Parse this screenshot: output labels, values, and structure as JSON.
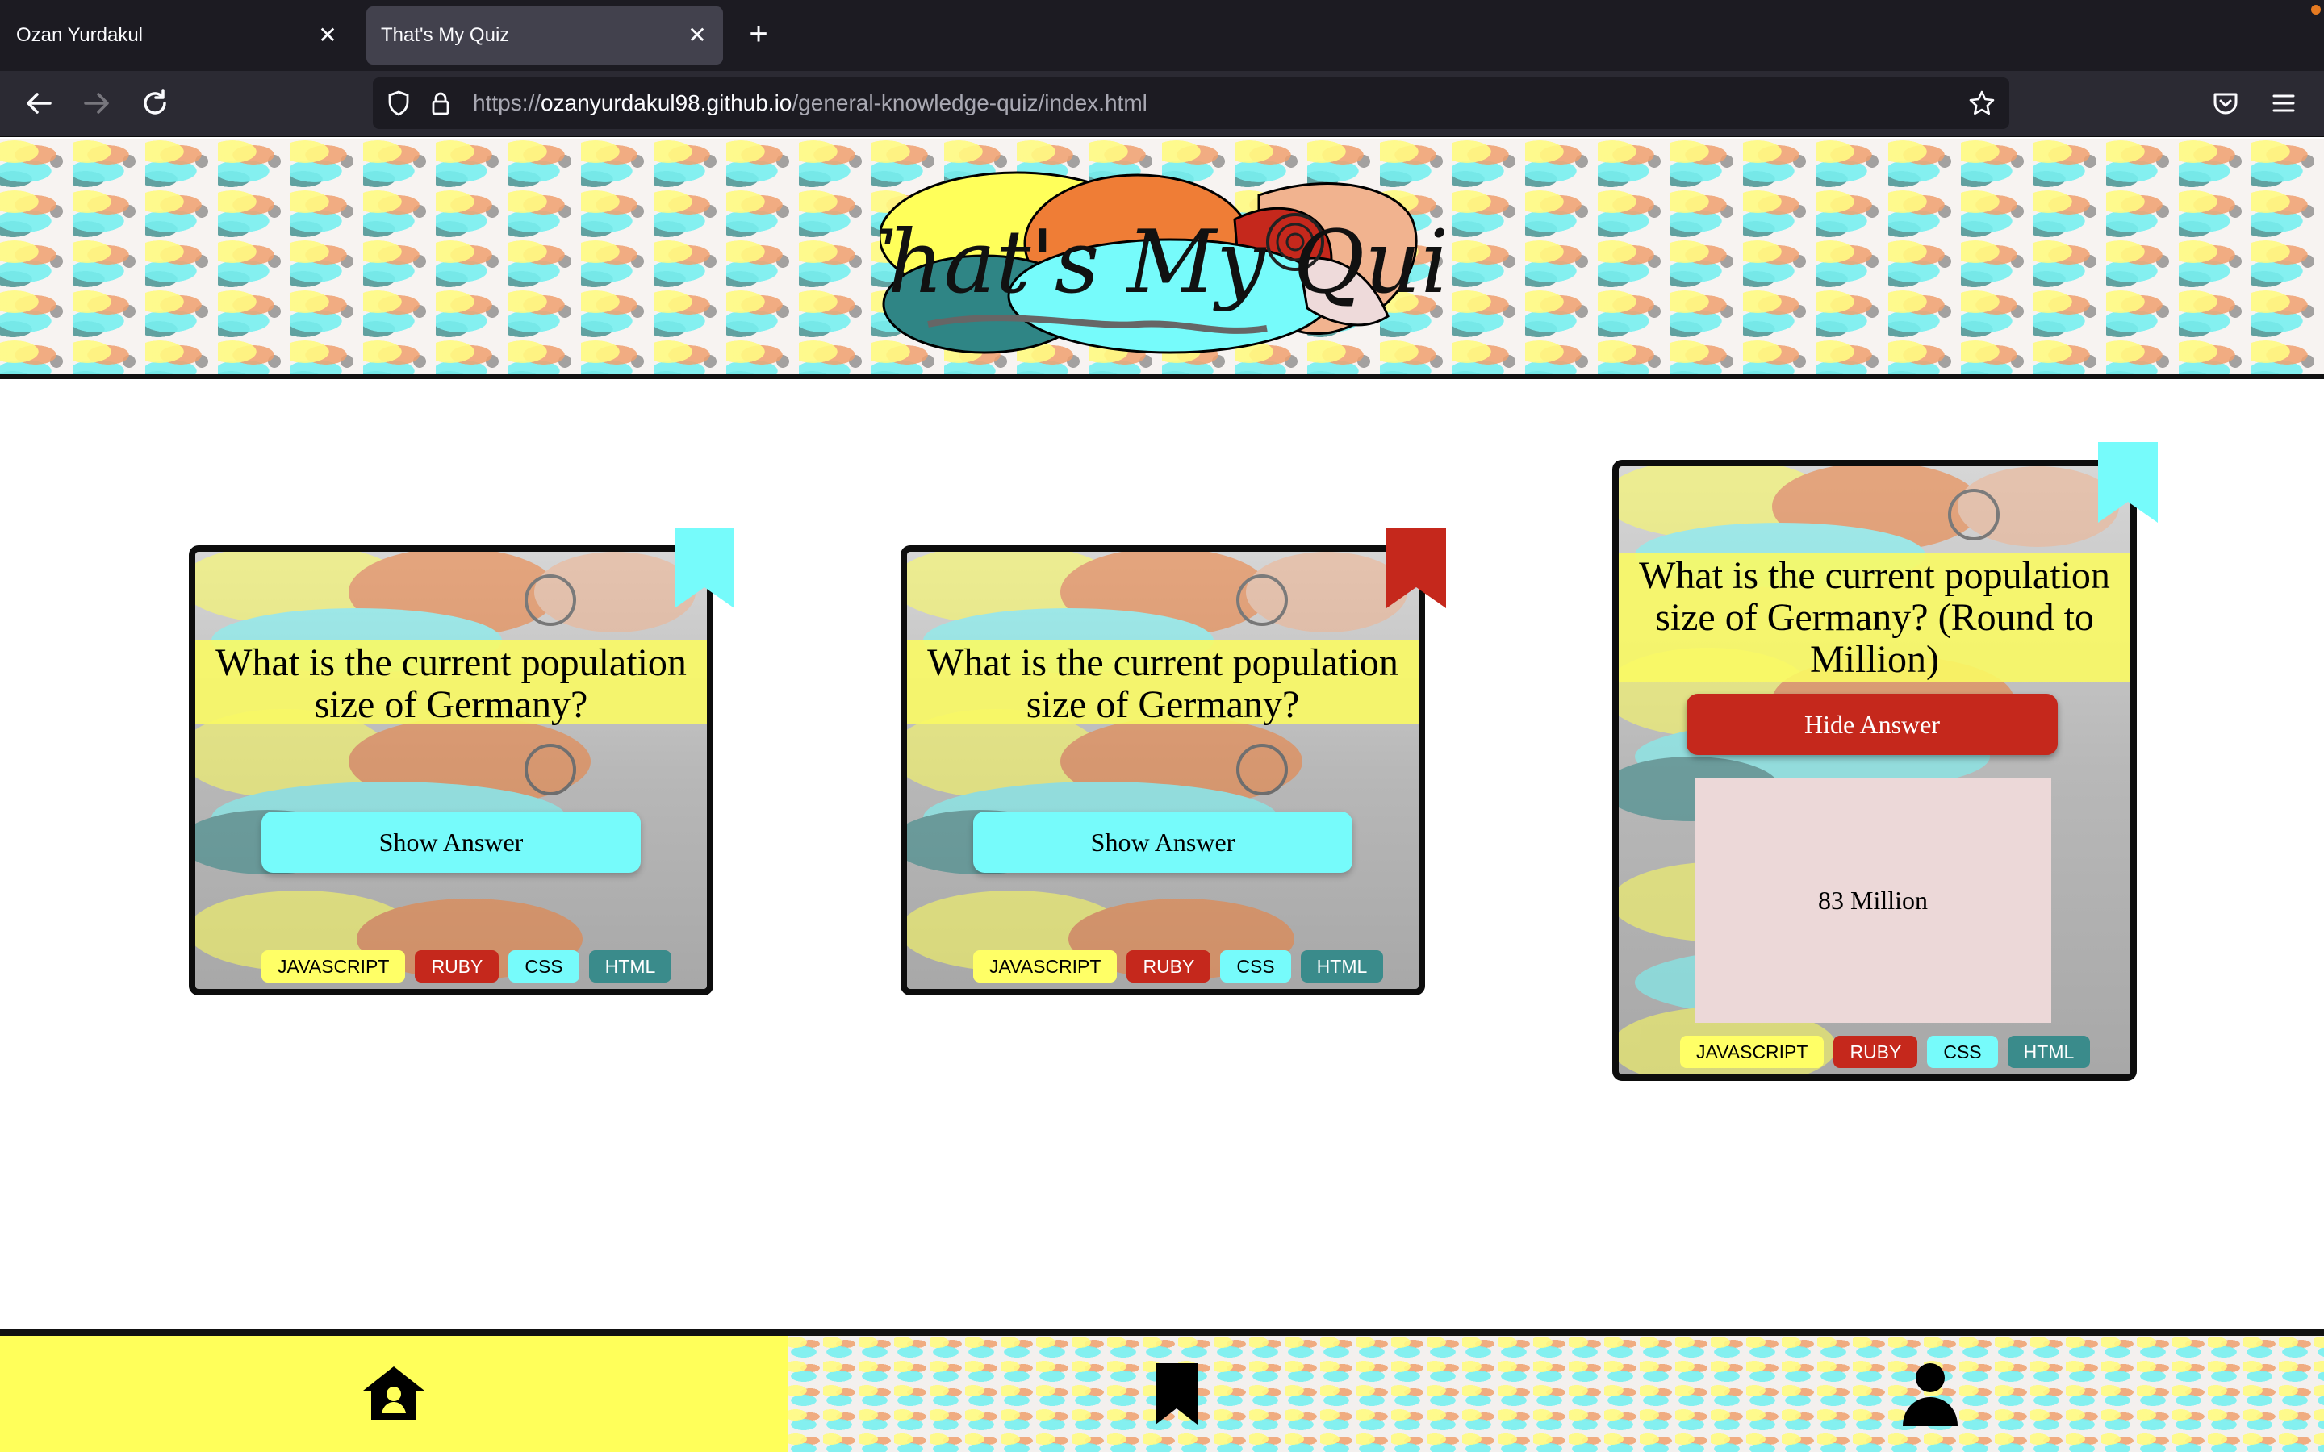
{
  "browser": {
    "tabs": [
      {
        "title": "Ozan Yurdakul",
        "active": false
      },
      {
        "title": "That's My Quiz",
        "active": true
      }
    ],
    "url_scheme": "https://",
    "url_host": "ozanyurdakul98.github.io",
    "url_path": "/general-knowledge-quiz/index.html"
  },
  "header": {
    "logo_text": "That's My Quiz"
  },
  "cards": [
    {
      "question": "What is the current population size of Germany?",
      "button_label": "Show Answer",
      "bookmark_color": "#76fbfb",
      "tags": [
        "JAVASCRIPT",
        "RUBY",
        "CSS",
        "HTML"
      ]
    },
    {
      "question": "What is the current population size of Germany?",
      "button_label": "Show Answer",
      "bookmark_color": "#c5281c",
      "tags": [
        "JAVASCRIPT",
        "RUBY",
        "CSS",
        "HTML"
      ]
    },
    {
      "question": "What is the current population size of Germany? (Round to Million)",
      "button_label": "Hide Answer",
      "answer": "83 Million",
      "bookmark_color": "#76fbfb",
      "tags": [
        "JAVASCRIPT",
        "RUBY",
        "CSS",
        "HTML"
      ]
    }
  ],
  "footer": {
    "items": [
      {
        "icon": "home-icon",
        "active": true
      },
      {
        "icon": "bookmark-icon",
        "active": false
      },
      {
        "icon": "profile-icon",
        "active": false
      }
    ],
    "active_color": "#ffff5a"
  },
  "colors": {
    "accent_cyan": "#76fbfb",
    "accent_red": "#c5281c",
    "accent_yellow": "#ffff66",
    "accent_teal": "#3a8b8b"
  }
}
